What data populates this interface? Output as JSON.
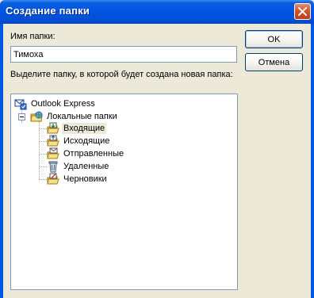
{
  "window": {
    "title": "Создание папки",
    "close_icon": "close-icon",
    "titlebar_color": "#0054e3",
    "close_color": "#d2502a"
  },
  "form": {
    "name_label": "Имя папки:",
    "name_value": "Тимоха",
    "select_label": "Выделите папку, в которой будет создана новая папка:"
  },
  "buttons": {
    "ok": "OK",
    "cancel": "Отмена"
  },
  "tree": {
    "root": {
      "label": "Outlook Express",
      "icon": "outlook-express-icon"
    },
    "local": {
      "label": "Локальные папки",
      "icon": "local-folders-icon",
      "expanded": true
    },
    "folders": [
      {
        "label": "Входящие",
        "icon": "inbox-icon",
        "selected": true
      },
      {
        "label": "Исходящие",
        "icon": "outbox-icon",
        "selected": false
      },
      {
        "label": "Отправленные",
        "icon": "sent-items-icon",
        "selected": false
      },
      {
        "label": "Удаленные",
        "icon": "deleted-items-icon",
        "selected": false
      },
      {
        "label": "Черновики",
        "icon": "drafts-icon",
        "selected": false
      }
    ]
  }
}
